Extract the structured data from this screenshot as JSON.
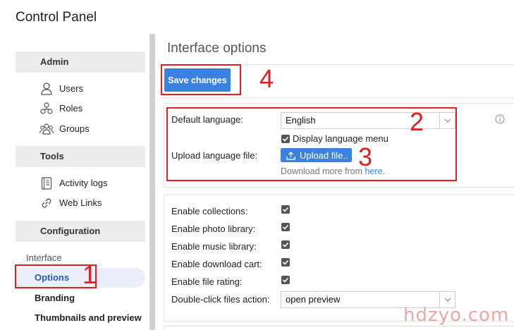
{
  "app": {
    "title": "Control Panel"
  },
  "sidebar": {
    "sections": [
      {
        "header": "Admin",
        "items": [
          {
            "label": "Users",
            "icon": "user-icon"
          },
          {
            "label": "Roles",
            "icon": "roles-icon"
          },
          {
            "label": "Groups",
            "icon": "groups-icon"
          }
        ]
      },
      {
        "header": "Tools",
        "items": [
          {
            "label": "Activity logs",
            "icon": "log-icon"
          },
          {
            "label": "Web Links",
            "icon": "link-icon"
          }
        ]
      },
      {
        "header": "Configuration",
        "items": []
      }
    ],
    "interface_group": "Interface",
    "interface_items": [
      {
        "label": "Options",
        "active": true
      },
      {
        "label": "Branding",
        "active": false
      },
      {
        "label": "Thumbnails and preview",
        "active": false
      }
    ]
  },
  "main": {
    "title": "Interface options",
    "save_label": "Save changes",
    "language": {
      "label": "Default language:",
      "value": "English",
      "display_menu_label": "Display language menu",
      "display_menu_checked": true,
      "upload_label": "Upload language file:",
      "upload_button": "Upload file..",
      "download_text": "Download more from ",
      "download_link": "here",
      "download_suffix": "."
    },
    "features": [
      {
        "label": "Enable collections:",
        "checked": true
      },
      {
        "label": "Enable photo library:",
        "checked": true
      },
      {
        "label": "Enable music library:",
        "checked": true
      },
      {
        "label": "Enable download cart:",
        "checked": true
      },
      {
        "label": "Enable file rating:",
        "checked": true
      }
    ],
    "double_click": {
      "label": "Double-click files action:",
      "value": "open preview"
    }
  },
  "annotations": [
    "1",
    "2",
    "3",
    "4"
  ],
  "watermark": "hdzyo.com",
  "colors": {
    "accent": "#3b82e0",
    "annotation": "#e02020",
    "active_bg": "#e9eef8"
  }
}
